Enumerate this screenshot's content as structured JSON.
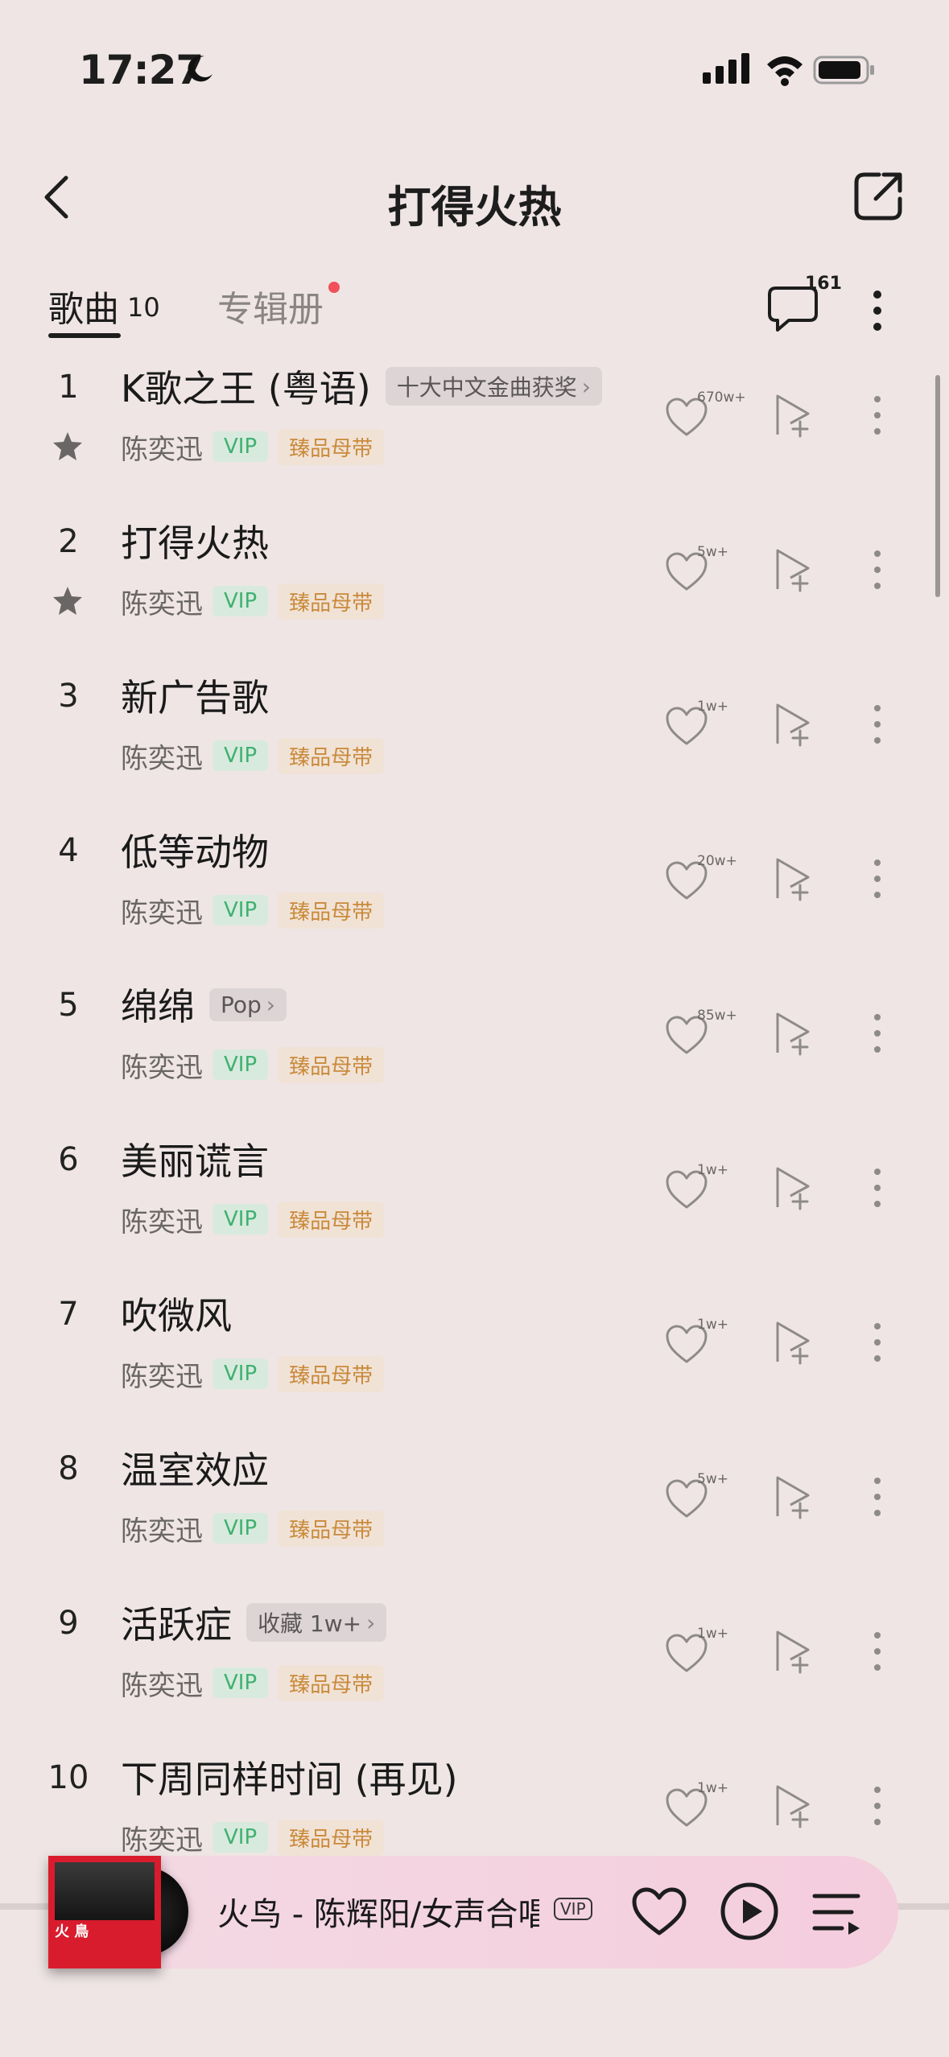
{
  "status_bar": {
    "time": "17:27"
  },
  "nav": {
    "title": "打得火热"
  },
  "tabs": {
    "songs_label": "歌曲",
    "songs_count": "10",
    "album_label": "专辑册",
    "comment_count": "161"
  },
  "songs": [
    {
      "num": "1",
      "title": "K歌之王 (粤语)",
      "tag": "十大中文金曲获奖",
      "starred": true,
      "artist": "陈奕迅",
      "vip": "VIP",
      "quality": "臻品母带",
      "likes": "670w+"
    },
    {
      "num": "2",
      "title": "打得火热",
      "tag": "",
      "starred": true,
      "artist": "陈奕迅",
      "vip": "VIP",
      "quality": "臻品母带",
      "likes": "5w+"
    },
    {
      "num": "3",
      "title": "新广告歌",
      "tag": "",
      "starred": false,
      "artist": "陈奕迅",
      "vip": "VIP",
      "quality": "臻品母带",
      "likes": "1w+"
    },
    {
      "num": "4",
      "title": "低等动物",
      "tag": "",
      "starred": false,
      "artist": "陈奕迅",
      "vip": "VIP",
      "quality": "臻品母带",
      "likes": "20w+"
    },
    {
      "num": "5",
      "title": "绵绵",
      "tag": "Pop",
      "starred": false,
      "artist": "陈奕迅",
      "vip": "VIP",
      "quality": "臻品母带",
      "likes": "85w+"
    },
    {
      "num": "6",
      "title": "美丽谎言",
      "tag": "",
      "starred": false,
      "artist": "陈奕迅",
      "vip": "VIP",
      "quality": "臻品母带",
      "likes": "1w+"
    },
    {
      "num": "7",
      "title": "吹微风",
      "tag": "",
      "starred": false,
      "artist": "陈奕迅",
      "vip": "VIP",
      "quality": "臻品母带",
      "likes": "1w+"
    },
    {
      "num": "8",
      "title": "温室效应",
      "tag": "",
      "starred": false,
      "artist": "陈奕迅",
      "vip": "VIP",
      "quality": "臻品母带",
      "likes": "5w+"
    },
    {
      "num": "9",
      "title": "活跃症",
      "tag": "收藏 1w+",
      "starred": false,
      "artist": "陈奕迅",
      "vip": "VIP",
      "quality": "臻品母带",
      "likes": "1w+"
    },
    {
      "num": "10",
      "title": "下周同样时间 (再见)",
      "tag": "",
      "starred": false,
      "artist": "陈奕迅",
      "vip": "VIP",
      "quality": "臻品母带",
      "likes": "1w+"
    }
  ],
  "now_playing": {
    "title": "火鸟 - 陈辉阳/女声合唱团",
    "vip": "VIP",
    "cover_text": "火 鳥"
  },
  "colors": {
    "background": "#efe5e5",
    "vip_green": "#3fb170",
    "quality_gold": "#c98a3a",
    "cover_red": "#d91c2d",
    "player_pink": "#f4cddd"
  }
}
